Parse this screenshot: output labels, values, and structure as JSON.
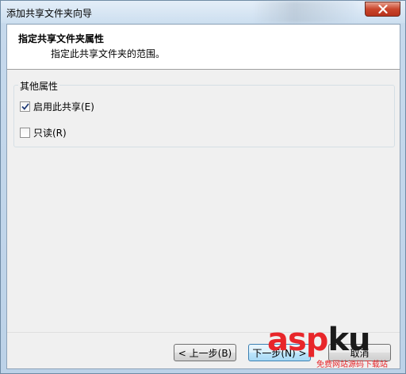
{
  "window": {
    "title": "添加共享文件夹向导"
  },
  "header": {
    "title": "指定共享文件夹属性",
    "subtitle": "指定此共享文件夹的范围。"
  },
  "group": {
    "label": "其他属性",
    "options": [
      {
        "label": "启用此共享(E)",
        "checked": true
      },
      {
        "label": "只读(R)",
        "checked": false
      }
    ]
  },
  "buttons": {
    "back": "< 上一步(B)",
    "next": "下一步(N) >",
    "cancel": "取消"
  },
  "watermark": {
    "brand": "asp",
    "brand_suffix": "ku",
    "tld": ".com",
    "slogan": "免费网站源码下载站"
  },
  "colors": {
    "accent": "#3c7fb1",
    "close": "#c9462c",
    "watermark_red": "#e8262a"
  }
}
